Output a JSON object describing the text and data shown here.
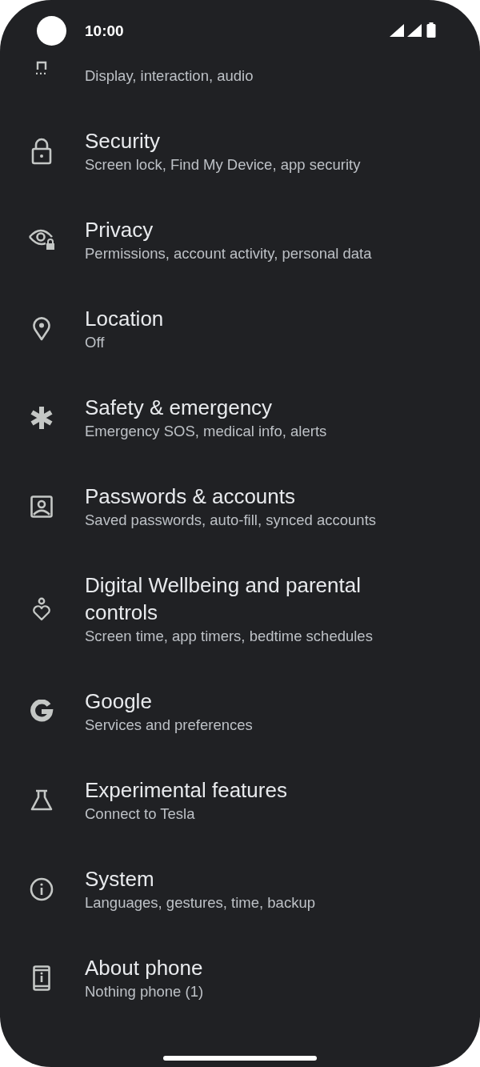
{
  "status_bar": {
    "time": "10:00"
  },
  "items": [
    {
      "subtitle": "Display, interaction, audio"
    },
    {
      "title": "Security",
      "subtitle": "Screen lock, Find My Device, app security"
    },
    {
      "title": "Privacy",
      "subtitle": "Permissions, account activity, personal data"
    },
    {
      "title": "Location",
      "subtitle": "Off"
    },
    {
      "title": "Safety & emergency",
      "subtitle": "Emergency SOS, medical info, alerts"
    },
    {
      "title": "Passwords & accounts",
      "subtitle": "Saved passwords, auto-fill, synced accounts"
    },
    {
      "title": "Digital Wellbeing and parental controls",
      "subtitle": "Screen time, app timers, bedtime schedules"
    },
    {
      "title": "Google",
      "subtitle": "Services and preferences"
    },
    {
      "title": "Experimental features",
      "subtitle": "Connect to Tesla"
    },
    {
      "title": "System",
      "subtitle": "Languages, gestures, time, backup"
    },
    {
      "title": "About phone",
      "subtitle": "Nothing phone (1)"
    }
  ]
}
